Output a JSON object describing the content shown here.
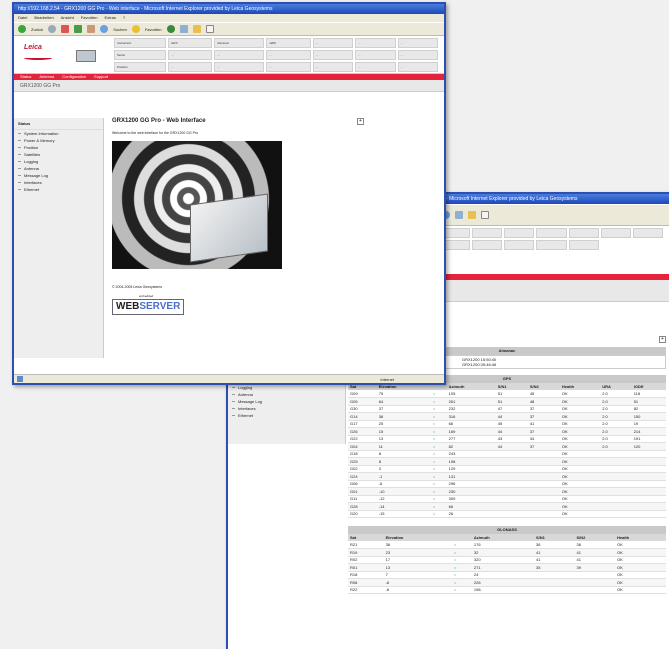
{
  "front": {
    "title": "http://192.168.2.54 - GRX1200 GG Pro - Web interface - Microsoft Internet Explorer provided by Leica Geosystems",
    "menu": [
      "Datei",
      "Bearbeiten",
      "Ansicht",
      "Favoriten",
      "Extras",
      "?"
    ],
    "toolbar": {
      "back": "Zurück",
      "search": "Suchen",
      "favorites": "Favoriten"
    },
    "logo": "Leica",
    "status_cells": [
      "Instrument",
      "GRX",
      "Receiver",
      "1200",
      "...",
      "...",
      "...",
      "Serial",
      "...",
      "...",
      "...",
      "...",
      "...",
      "...",
      "Position",
      "...",
      "...",
      "...",
      "...",
      "...",
      "..."
    ],
    "nav": [
      "Status",
      "Antenna",
      "Configuration",
      "Support"
    ],
    "subhead": "GRX1200 GG Pro",
    "sidebar_title": "Status",
    "sidebar_items": [
      "System Information",
      "Power & Memory",
      "Position",
      "Satellites",
      "Logging",
      "Antenna",
      "Message Log",
      "Interfaces",
      "Ethernet"
    ],
    "page_heading": "GRX1200 GG Pro - Web Interface",
    "welcome": "Welcome to the web interface for the GRX1200 GG Pro",
    "copyright": "© 2004-2005 Leica Geosystems",
    "badge_small": "embedded",
    "badge_a": "WEB",
    "badge_b": "SERVER",
    "status_left": "",
    "status_right": "Internet"
  },
  "back": {
    "title": "- Microsoft Internet Explorer provided by Leica Geosystems",
    "sidebar_items": [
      "Logging",
      "Antenna",
      "Message Log",
      "Interfaces",
      "Ethernet"
    ],
    "almanac_title": "Almanac",
    "almanac_rows": [
      "GRX1200 15:50:40",
      "GRX1200 05:46:46"
    ],
    "gps_title": "GPS",
    "gps_headers": [
      "Sat",
      "Elevation",
      "",
      "Azimuth",
      "S/N1",
      "S/N2",
      "Health",
      "URA",
      "IODE"
    ],
    "gps_rows": [
      [
        "G09",
        "75",
        "=",
        "105",
        "51",
        "45",
        "OK",
        "2.0",
        "118"
      ],
      [
        "G05",
        "64",
        "=",
        "261",
        "51",
        "48",
        "OK",
        "2.0",
        "51"
      ],
      [
        "G30",
        "37",
        "=",
        "232",
        "47",
        "37",
        "OK",
        "2.0",
        "82"
      ],
      [
        "G14",
        "36",
        "=",
        "316",
        "44",
        "37",
        "OK",
        "2.0",
        "150"
      ],
      [
        "G17",
        "25",
        "=",
        "66",
        "45",
        "41",
        "OK",
        "2.0",
        "19"
      ],
      [
        "G26",
        "15",
        "=",
        "169",
        "44",
        "37",
        "OK",
        "2.0",
        "214"
      ],
      [
        "G22",
        "13",
        "=",
        "277",
        "43",
        "34",
        "OK",
        "2.0",
        "191"
      ],
      [
        "G04",
        "11",
        "=",
        "82",
        "44",
        "37",
        "OK",
        "2.0",
        "120"
      ],
      [
        "G18",
        "8",
        "=",
        "243",
        "",
        "",
        "OK",
        "",
        ""
      ],
      [
        "G25",
        "8",
        "=",
        "198",
        "",
        "",
        "OK",
        "",
        ""
      ],
      [
        "G02",
        "3",
        "=",
        "129",
        "",
        "",
        "OK",
        "",
        ""
      ],
      [
        "G24",
        "-1",
        "=",
        "131",
        "",
        "",
        "OK",
        "",
        ""
      ],
      [
        "G06",
        "-6",
        "=",
        "296",
        "",
        "",
        "OK",
        "",
        ""
      ],
      [
        "G01",
        "-10",
        "=",
        "230",
        "",
        "",
        "OK",
        "",
        ""
      ],
      [
        "G11",
        "-12",
        "=",
        "309",
        "",
        "",
        "OK",
        "",
        ""
      ],
      [
        "G28",
        "-14",
        "=",
        "66",
        "",
        "",
        "OK",
        "",
        ""
      ],
      [
        "G20",
        "-15",
        "=",
        "26",
        "",
        "",
        "OK",
        "",
        ""
      ]
    ],
    "glonass_title": "GLONASS",
    "glonass_headers": [
      "Sat",
      "Elevation",
      "",
      "Azimuth",
      "S/N1",
      "S/N2",
      "Health"
    ],
    "glonass_rows": [
      [
        "R21",
        "36",
        "=",
        "176",
        "36",
        "36",
        "OK"
      ],
      [
        "R19",
        "23",
        "=",
        "32",
        "41",
        "41",
        "OK"
      ],
      [
        "R02",
        "17",
        "=",
        "320",
        "41",
        "41",
        "OK"
      ],
      [
        "R01",
        "13",
        "=",
        "271",
        "35",
        "39",
        "OK"
      ],
      [
        "R18",
        "7",
        "=",
        "24",
        "",
        "",
        "OK"
      ],
      [
        "R08",
        "-6",
        "=",
        "226",
        "",
        "",
        "OK"
      ],
      [
        "R22",
        "-6",
        "=",
        "198",
        "",
        "",
        "OK"
      ]
    ]
  },
  "colors": {
    "accent_red": "#e5243b",
    "titlebar_blue": "#2d4fb0",
    "leica_red": "#c8102e"
  }
}
